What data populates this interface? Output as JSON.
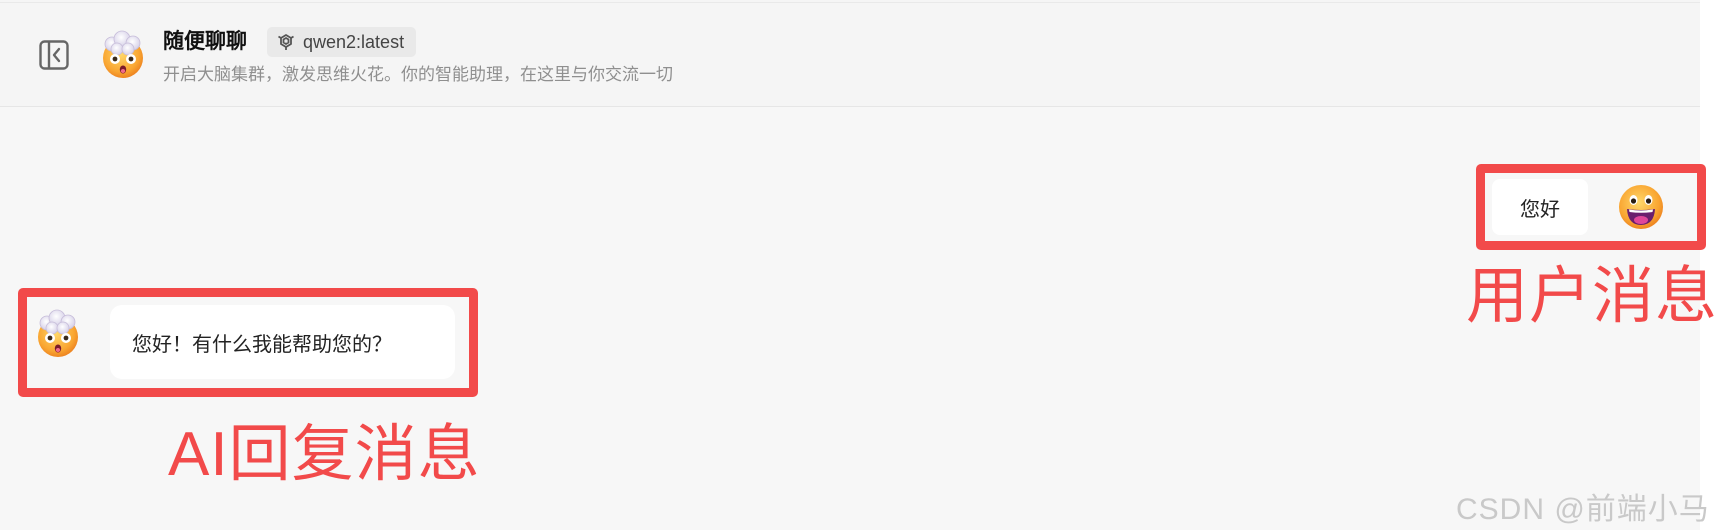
{
  "header": {
    "title": "随便聊聊",
    "model_tag": "qwen2:latest",
    "subtitle": "开启大脑集群，激发思维火花。你的智能助理，在这里与你交流一切",
    "assistant_avatar_icon": "exploding-head-emoji-icon",
    "sidebar_toggle_icon": "sidebar-collapse-icon",
    "model_icon": "model-logo-icon"
  },
  "messages": [
    {
      "role": "user",
      "text": "您好",
      "avatar_icon": "grinning-face-emoji-icon"
    },
    {
      "role": "assistant",
      "text": "您好！有什么我能帮助您的？",
      "avatar_icon": "exploding-head-emoji-icon"
    }
  ],
  "annotations": {
    "user_label": "用户消息",
    "ai_label": "AI回复消息",
    "highlight_color": "#f24a4a"
  },
  "watermark": "CSDN @前端小马",
  "colors": {
    "background": "#f7f7f7",
    "bubble": "#ffffff",
    "subtitle": "#8f8f8f"
  }
}
